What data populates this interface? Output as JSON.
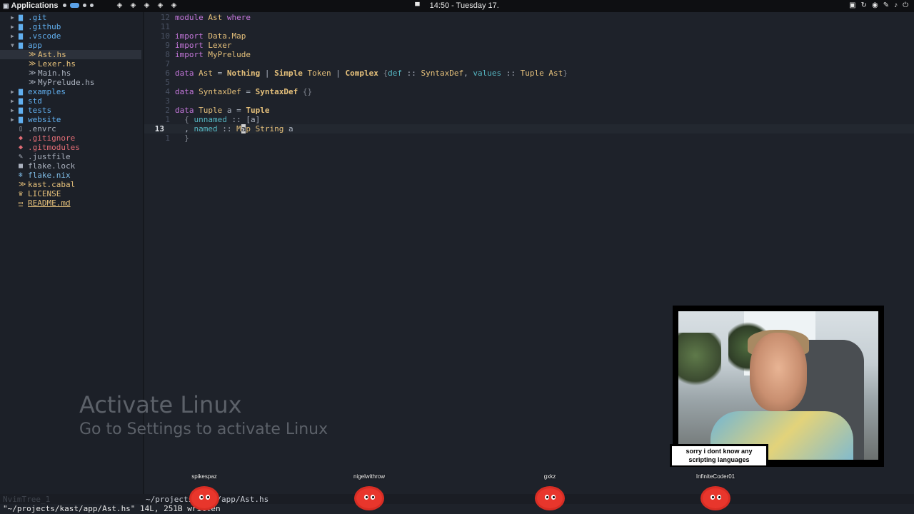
{
  "topbar": {
    "applications": "Applications",
    "clock": "14:50 - Tuesday 17.",
    "tray_left_icons": [
      "diamond-icon",
      "diamond-icon",
      "diamond-icon",
      "diamond-icon",
      "diamond-icon"
    ],
    "tray_right_icons": [
      "gamepad-icon",
      "sync-icon",
      "shield-icon",
      "pen-icon",
      "volume-icon",
      "power-icon"
    ]
  },
  "sidebar": {
    "items": [
      {
        "label": ".git",
        "type": "folder",
        "arrow": "▶"
      },
      {
        "label": ".github",
        "type": "folder",
        "arrow": "▶"
      },
      {
        "label": ".vscode",
        "type": "folder",
        "arrow": "▶"
      },
      {
        "label": "app",
        "type": "folder-open",
        "arrow": "▼"
      },
      {
        "label": "Ast.hs",
        "type": "hs",
        "selected": true
      },
      {
        "label": "Lexer.hs",
        "type": "hs"
      },
      {
        "label": "Main.hs",
        "type": "hs-plain"
      },
      {
        "label": "MyPrelude.hs",
        "type": "hs-plain"
      },
      {
        "label": "examples",
        "type": "folder",
        "arrow": "▶"
      },
      {
        "label": "std",
        "type": "folder",
        "arrow": "▶"
      },
      {
        "label": "tests",
        "type": "folder",
        "arrow": "▶"
      },
      {
        "label": "website",
        "type": "folder",
        "arrow": "▶"
      },
      {
        "label": ".envrc",
        "type": "file"
      },
      {
        "label": ".gitignore",
        "type": "git"
      },
      {
        "label": ".gitmodules",
        "type": "git"
      },
      {
        "label": ".justfile",
        "type": "wrench"
      },
      {
        "label": "flake.lock",
        "type": "lock"
      },
      {
        "label": "flake.nix",
        "type": "nix"
      },
      {
        "label": "kast.cabal",
        "type": "cabal"
      },
      {
        "label": "LICENSE",
        "type": "license"
      },
      {
        "label": "README.md",
        "type": "md"
      }
    ]
  },
  "editor": {
    "line_numbers": [
      "12",
      "11",
      "10",
      "9",
      "8",
      "7",
      "6",
      "5",
      "4",
      "3",
      "2",
      "1",
      "13",
      "1"
    ],
    "lines": [
      "module Ast where",
      "",
      "import Data.Map",
      "import Lexer",
      "import MyPrelude",
      "",
      "data Ast = Nothing | Simple Token | Complex {def :: SyntaxDef, values :: Tuple Ast}",
      "",
      "data SyntaxDef = SyntaxDef {}",
      "",
      "data Tuple a = Tuple",
      "  { unnamed :: [a]",
      "  , named :: Map String a",
      "  }"
    ],
    "current_line_index": 12
  },
  "watermark": {
    "title": "Activate Linux",
    "subtitle": "Go to Settings to activate Linux"
  },
  "statusline": {
    "left": "NvimTree_1",
    "right": "~/projects/kast/app/Ast.hs"
  },
  "message": "\"~/projects/kast/app/Ast.hs\" 14L, 251B written",
  "overlay": {
    "caption": "sorry i dont know any scripting languages",
    "viewers": [
      "spikespaz",
      "nigelwithrow",
      "gxkz",
      "InfiniteCoder01"
    ]
  }
}
